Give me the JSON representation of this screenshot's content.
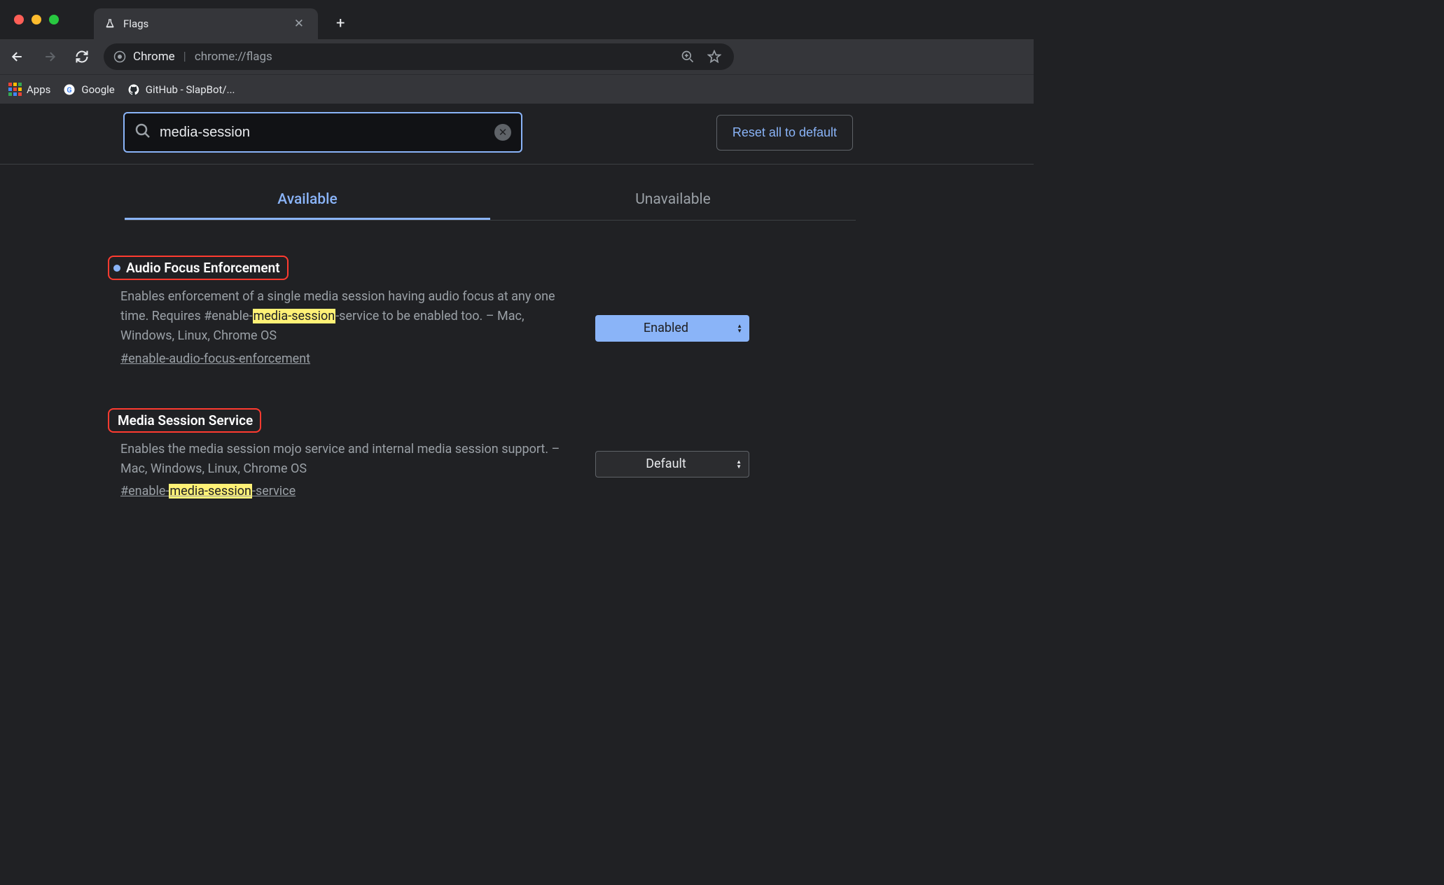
{
  "tab": {
    "title": "Flags"
  },
  "toolbar": {
    "address_label": "Chrome",
    "url": "chrome://flags"
  },
  "bookmarks": {
    "apps": "Apps",
    "google": "Google",
    "github": "GitHub - SlapBot/..."
  },
  "flags": {
    "search_value": "media-session",
    "reset_label": "Reset all to default",
    "tabs": {
      "available": "Available",
      "unavailable": "Unavailable"
    },
    "items": [
      {
        "title": "Audio Focus Enforcement",
        "has_dot": true,
        "desc_pre": "Enables enforcement of a single media session having audio focus at any one time. Requires #enable-",
        "desc_hl": "media-session",
        "desc_post": "-service to be enabled too. – Mac, Windows, Linux, Chrome OS",
        "anchor_pre": "#enable-audio-focus-enforcement",
        "anchor_hl": "",
        "anchor_post": "",
        "select": "Enabled",
        "select_style": "enabled"
      },
      {
        "title": "Media Session Service",
        "has_dot": false,
        "desc_pre": "Enables the media session mojo service and internal media session support. – Mac, Windows, Linux, Chrome OS",
        "desc_hl": "",
        "desc_post": "",
        "anchor_pre": "#enable-",
        "anchor_hl": "media-session",
        "anchor_post": "-service",
        "select": "Default",
        "select_style": "default"
      }
    ]
  }
}
